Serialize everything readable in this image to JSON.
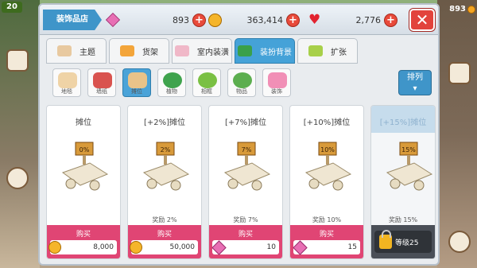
{
  "hud": {
    "level": "20",
    "right_coins": "893"
  },
  "panel": {
    "shop_title": "装饰品店",
    "gems": "893",
    "coins": "363,414",
    "hearts": "2,776"
  },
  "tabs": [
    {
      "label": "主题",
      "active": false,
      "icon_color": "#e8c9a0"
    },
    {
      "label": "货架",
      "active": false,
      "icon_color": "#f3a53a"
    },
    {
      "label": "室内装潢",
      "active": false,
      "icon_color": "#f0b8c8"
    },
    {
      "label": "装扮背景",
      "active": true,
      "icon_color": "#3aa04a"
    },
    {
      "label": "扩张",
      "active": false,
      "icon_color": "#a8d04a"
    }
  ],
  "categories": [
    {
      "label": "地毯",
      "active": false,
      "icon_color": "#efd3a6"
    },
    {
      "label": "墙纸",
      "active": false,
      "icon_color": "#d9534f"
    },
    {
      "label": "摊位",
      "active": true,
      "icon_color": "#e9c389"
    },
    {
      "label": "植物",
      "active": false,
      "icon_color": "#3fa34d"
    },
    {
      "label": "相框",
      "active": false,
      "icon_color": "#7ac043"
    },
    {
      "label": "物品",
      "active": false,
      "icon_color": "#5cae4f"
    },
    {
      "label": "装饰",
      "active": false,
      "icon_color": "#f18fb6"
    }
  ],
  "sort_button": "排列",
  "cards": [
    {
      "name": "摊位",
      "reward": "",
      "buy": "购买",
      "currency": "coin",
      "price": "8,000",
      "sign": "0%",
      "locked": false
    },
    {
      "name": "[+2%]摊位",
      "reward": "奖励 2%",
      "buy": "购买",
      "currency": "coin",
      "price": "50,000",
      "sign": "2%",
      "locked": false
    },
    {
      "name": "[+7%]摊位",
      "reward": "奖励 7%",
      "buy": "购买",
      "currency": "gem",
      "price": "10",
      "sign": "7%",
      "locked": false
    },
    {
      "name": "[+10%]摊位",
      "reward": "奖励 10%",
      "buy": "购买",
      "currency": "gem",
      "price": "15",
      "sign": "10%",
      "locked": false
    },
    {
      "name": "[+15%]摊位",
      "reward": "奖励 15%",
      "buy": "",
      "currency": "lock",
      "price": "等级25",
      "sign": "15%",
      "locked": true
    }
  ],
  "colors": {
    "accent": "#45a2d8",
    "buy": "#e04574",
    "close": "#e2433c"
  }
}
